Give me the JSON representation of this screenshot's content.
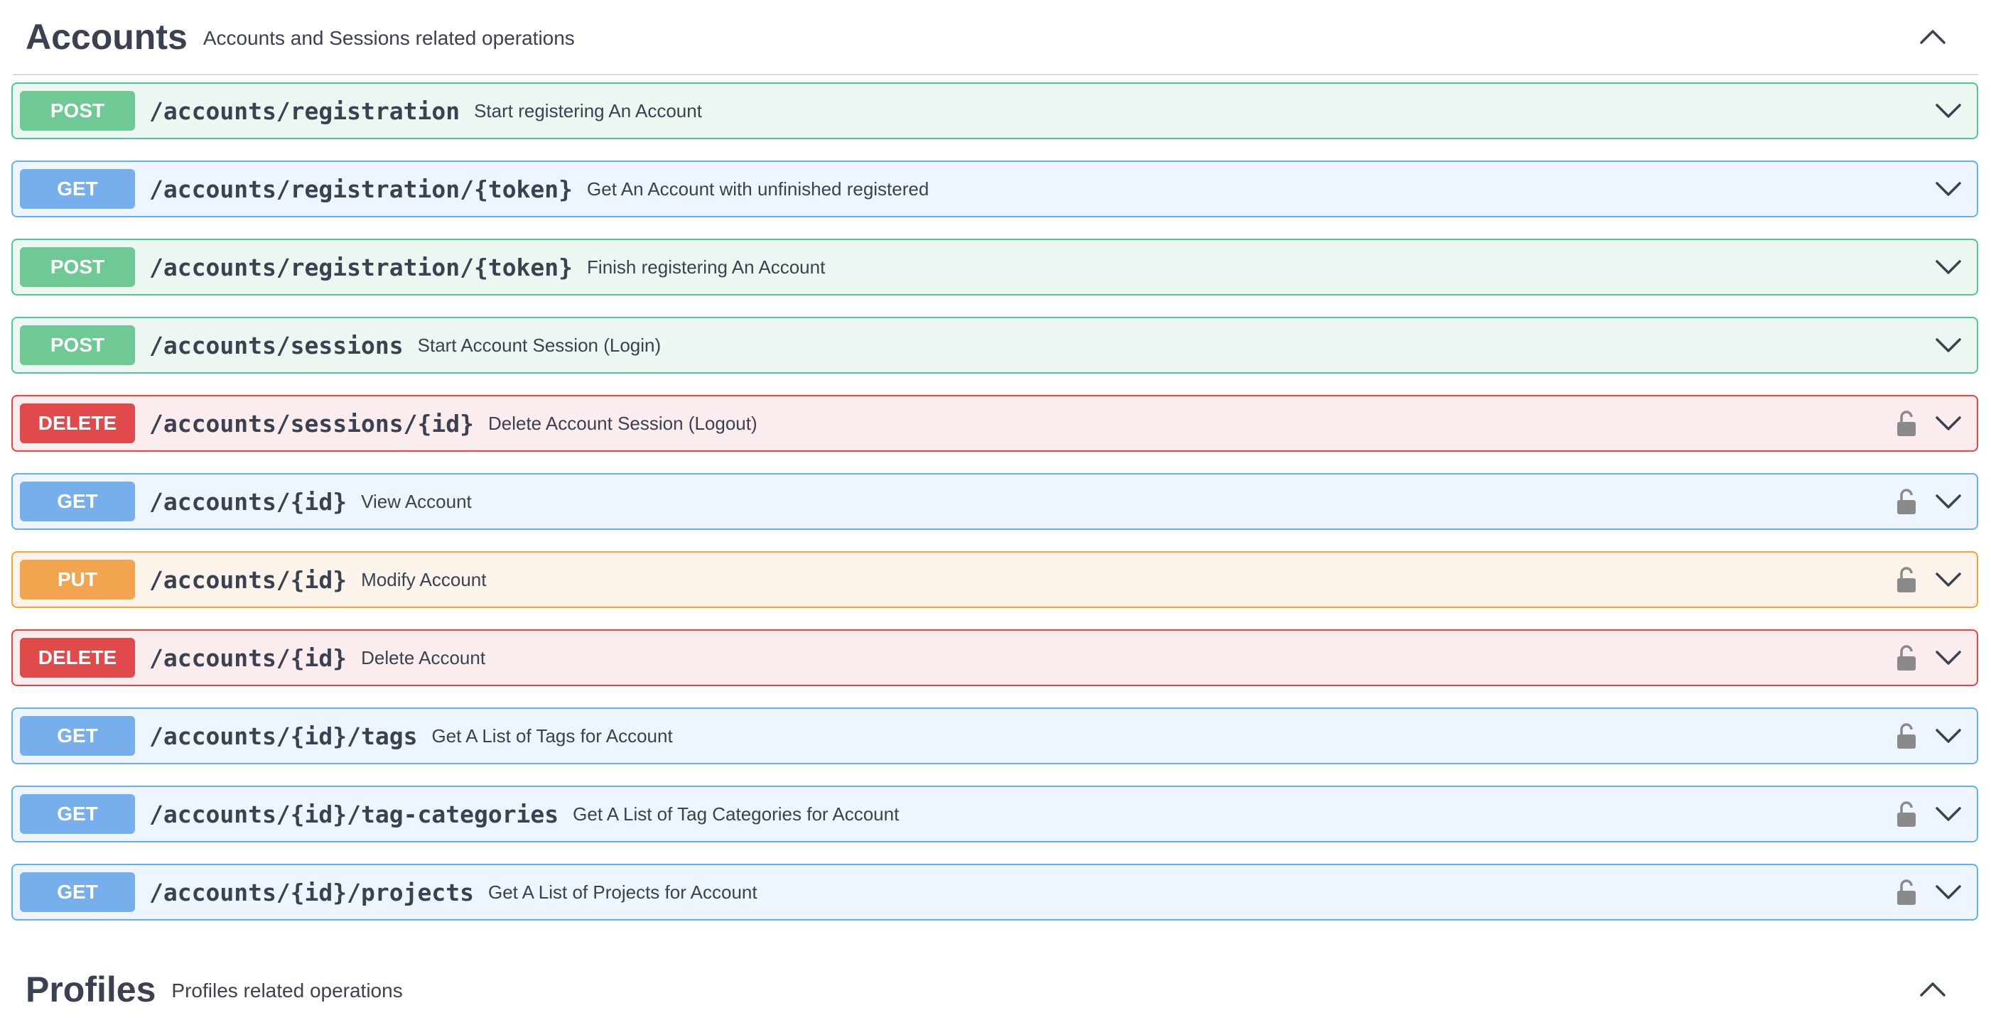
{
  "sections": [
    {
      "title": "Accounts",
      "description": "Accounts and Sessions related operations",
      "toggle_icon": "chevron-up-icon"
    },
    {
      "title": "Profiles",
      "description": "Profiles related operations",
      "toggle_icon": "chevron-up-icon"
    }
  ],
  "operations": [
    {
      "method": "POST",
      "path": "/accounts/registration",
      "summary": "Start registering An Account",
      "locked": false
    },
    {
      "method": "GET",
      "path": "/accounts/registration/{token}",
      "summary": "Get An Account with unfinished registered",
      "locked": false
    },
    {
      "method": "POST",
      "path": "/accounts/registration/{token}",
      "summary": "Finish registering An Account",
      "locked": false
    },
    {
      "method": "POST",
      "path": "/accounts/sessions",
      "summary": "Start Account Session (Login)",
      "locked": false
    },
    {
      "method": "DELETE",
      "path": "/accounts/sessions/{id}",
      "summary": "Delete Account Session (Logout)",
      "locked": true
    },
    {
      "method": "GET",
      "path": "/accounts/{id}",
      "summary": "View Account",
      "locked": true
    },
    {
      "method": "PUT",
      "path": "/accounts/{id}",
      "summary": "Modify Account",
      "locked": true
    },
    {
      "method": "DELETE",
      "path": "/accounts/{id}",
      "summary": "Delete Account",
      "locked": true
    },
    {
      "method": "GET",
      "path": "/accounts/{id}/tags",
      "summary": "Get A List of Tags for Account",
      "locked": true
    },
    {
      "method": "GET",
      "path": "/accounts/{id}/tag-categories",
      "summary": "Get A List of Tag Categories for Account",
      "locked": true
    },
    {
      "method": "GET",
      "path": "/accounts/{id}/projects",
      "summary": "Get A List of Projects for Account",
      "locked": true
    }
  ],
  "colors": {
    "post": "#49cc90",
    "get": "#61affe",
    "delete": "#f93e3e",
    "put": "#fca130",
    "lock": "#8a8a8a",
    "text": "#3b4151"
  },
  "icons": {
    "lock": "unlocked-padlock-icon",
    "expand": "chevron-down-icon",
    "collapse": "chevron-up-icon"
  }
}
